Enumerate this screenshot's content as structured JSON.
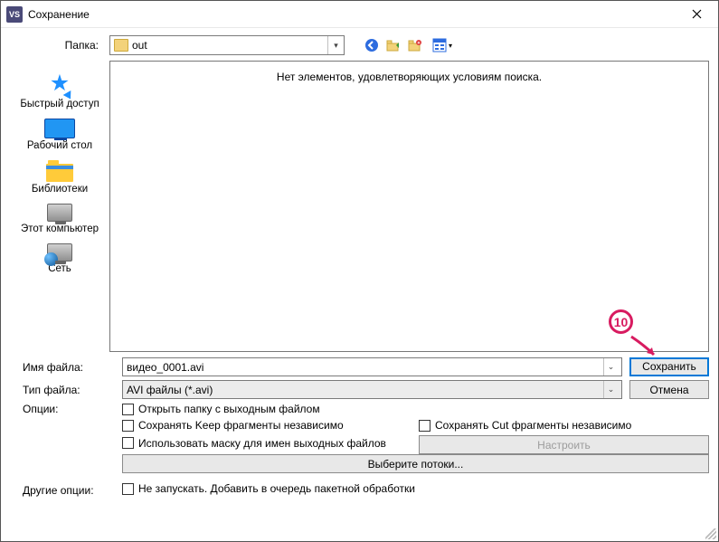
{
  "window": {
    "title": "Сохранение",
    "app_icon_text": "VS"
  },
  "folder_label": "Папка:",
  "folder_value": "out",
  "empty_message": "Нет элементов, удовлетворяющих условиям поиска.",
  "sidebar": {
    "items": [
      {
        "label": "Быстрый доступ"
      },
      {
        "label": "Рабочий стол"
      },
      {
        "label": "Библиотеки"
      },
      {
        "label": "Этот компьютер"
      },
      {
        "label": "Сеть"
      }
    ]
  },
  "form": {
    "filename_label": "Имя файла:",
    "filename_value": "видео_0001.avi",
    "filetype_label": "Тип файла:",
    "filetype_value": "AVI файлы (*.avi)",
    "save_button": "Сохранить",
    "cancel_button": "Отмена"
  },
  "options": {
    "label": "Опции:",
    "open_folder": "Открыть папку с выходным файлом",
    "keep_fragments": "Сохранять Keep фрагменты независимо",
    "cut_fragments": "Сохранять Cut фрагменты независимо",
    "use_mask": "Использовать маску для имен выходных файлов",
    "configure_button": "Настроить",
    "select_streams_button": "Выберите потоки..."
  },
  "other_options": {
    "label": "Другие опции:",
    "batch_queue": "Не запускать. Добавить в очередь пакетной обработки"
  },
  "annotation": {
    "number": "10"
  }
}
